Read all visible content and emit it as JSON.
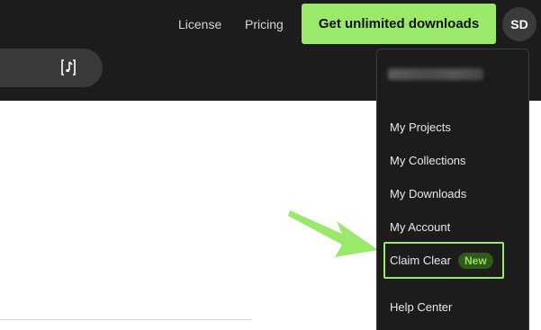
{
  "header": {
    "nav_links": [
      "License",
      "Pricing"
    ],
    "cta_label": "Get unlimited downloads",
    "avatar_initials": "SD",
    "accent_color": "#9ae96b"
  },
  "search": {
    "icon": "music-note-icon"
  },
  "dropdown": {
    "items": [
      {
        "label": "My Projects"
      },
      {
        "label": "My Collections"
      },
      {
        "label": "My Downloads"
      },
      {
        "label": "My Account"
      },
      {
        "label": "Claim Clear",
        "badge": "New"
      },
      {
        "label": "Help Center"
      }
    ]
  }
}
